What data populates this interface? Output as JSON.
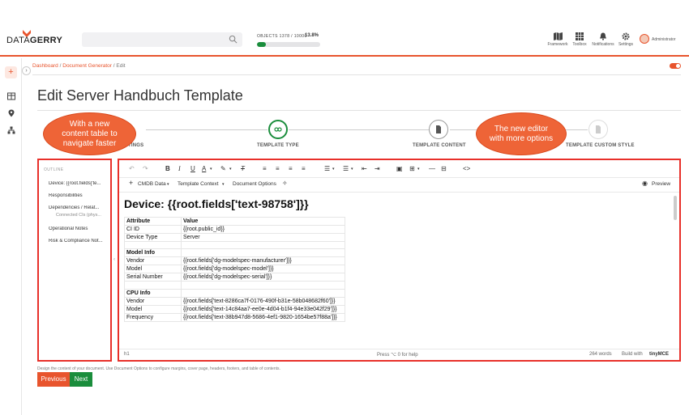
{
  "brand": {
    "part1": "DATA",
    "part2": "GERRY",
    "accent": "#e8542d",
    "mark": "orange-corner-icon"
  },
  "header": {
    "objects_label": "OBJECTS 1378 / 10000",
    "objects_percent": "13.8%",
    "objects_progress": 0.138,
    "nav": [
      {
        "icon": "map-icon",
        "label": "Framework"
      },
      {
        "icon": "grid-icon",
        "label": "Toolbox"
      },
      {
        "icon": "bell-icon",
        "label": "Notifications"
      },
      {
        "icon": "gear-icon",
        "label": "Settings"
      }
    ],
    "user": "Administrator"
  },
  "breadcrumb": {
    "items": [
      "Dashboard",
      "Document Generator",
      "Edit"
    ],
    "separator": "/"
  },
  "page_title": "Edit Server Handbuch Template",
  "steps": [
    {
      "label": "TINGS"
    },
    {
      "label": "TEMPLATE TYPE"
    },
    {
      "label": "TEMPLATE CONTENT"
    },
    {
      "label": "TEMPLATE CUSTOM STYLE"
    }
  ],
  "callouts": {
    "left": "With a new content table to navigate faster",
    "right": "The new editor with more options"
  },
  "outline": {
    "heading": "OUTLINE",
    "items": [
      {
        "label": "Device: {{root.fields['te..."
      },
      {
        "label": "Responsibilities"
      },
      {
        "label": "Dependencies / Relat..."
      },
      {
        "label": "Connected CIs (phys...",
        "sub": true
      },
      {
        "label": "Operational Notes"
      },
      {
        "label": "Risk & Compliance Not..."
      }
    ]
  },
  "toolbar2": {
    "cmdb": "CMDB Data",
    "context": "Template Context",
    "options": "Document Options",
    "preview": "Preview"
  },
  "doc": {
    "heading": "Device: {{root.fields['text-98758']}}",
    "rows": [
      [
        "Attribute",
        "Value",
        "header"
      ],
      [
        "CI ID",
        "{{root.public_id}}",
        ""
      ],
      [
        "Device Type",
        "Server",
        ""
      ],
      [
        "",
        "",
        ""
      ],
      [
        "Model Info",
        "",
        "header"
      ],
      [
        "Vendor",
        "{{root.fields['dg-modelspec-manufacturer']}}",
        ""
      ],
      [
        "Model",
        "{{root.fields['dg-modelspec-model']}}",
        ""
      ],
      [
        "Serial Number",
        "{{root.fields['dg-modelspec-serial']}}",
        ""
      ],
      [
        "",
        "",
        ""
      ],
      [
        "CPU Info",
        "",
        "header"
      ],
      [
        "Vendor",
        "{{root.fields['text-8286ca7f-0176-490f-b31e-58b048682f60']}}",
        ""
      ],
      [
        "Model",
        "{{root.fields['text-14c84aa7-ee0e-4d04-b1f4-94e33e042f29']}}",
        ""
      ],
      [
        "Frequency",
        "{{root.fields['text-38b947d8-5686-4ef1-9820-1654be57f88a']}}",
        ""
      ]
    ]
  },
  "status": {
    "element": "h1",
    "help": "Press ⌥ 0 for help",
    "words": "264 words",
    "built": "Build with",
    "brand": "tinyMCE"
  },
  "footer": {
    "note": "Design the content of your document. Use Document Options to configure margins, cover page, headers, footers, and table of contents.",
    "previous": "Previous",
    "next": "Next"
  }
}
